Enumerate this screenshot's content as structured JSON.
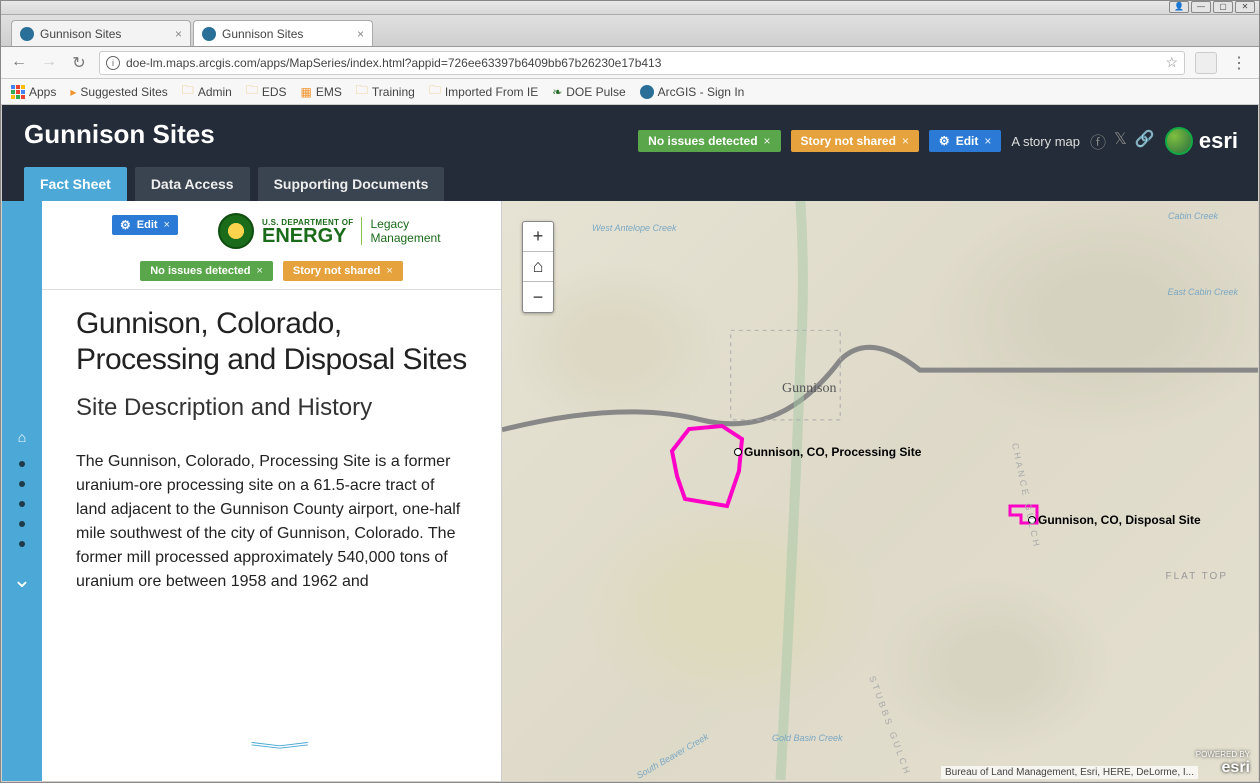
{
  "os": {
    "user": "👤",
    "min": "—",
    "max": "▢",
    "close": "✕"
  },
  "browser": {
    "tabs": [
      {
        "title": "Gunnison Sites",
        "active": false
      },
      {
        "title": "Gunnison Sites",
        "active": true
      }
    ],
    "url": "doe-lm.maps.arcgis.com/apps/MapSeries/index.html?appid=726ee63397b6409bb67b26230e17b413",
    "nav": {
      "back": "←",
      "fwd": "→",
      "reload": "↻"
    }
  },
  "bookmarks": [
    {
      "label": "Apps",
      "kind": "apps"
    },
    {
      "label": "Suggested Sites",
      "kind": "folder",
      "color": "#f0932b"
    },
    {
      "label": "Admin",
      "kind": "folder"
    },
    {
      "label": "EDS",
      "kind": "folder"
    },
    {
      "label": "EMS",
      "kind": "icon",
      "color": "#f0932b"
    },
    {
      "label": "Training",
      "kind": "folder"
    },
    {
      "label": "Imported From IE",
      "kind": "folder"
    },
    {
      "label": "DOE Pulse",
      "kind": "leaf"
    },
    {
      "label": "ArcGIS - Sign In",
      "kind": "globe"
    }
  ],
  "header": {
    "title": "Gunnison Sites",
    "issues_pill": "No issues detected",
    "share_pill": "Story not shared",
    "edit_pill": "Edit",
    "story_label": "A story map",
    "logo_text": "esri"
  },
  "app_tabs": [
    {
      "label": "Fact Sheet",
      "active": true
    },
    {
      "label": "Data Access",
      "active": false
    },
    {
      "label": "Supporting Documents",
      "active": false
    }
  ],
  "panel": {
    "edit_pill": "Edit",
    "issues_pill": "No issues detected",
    "share_pill": "Story not shared",
    "doe_small": "U.S. DEPARTMENT OF",
    "doe_big": "ENERGY",
    "doe_lm_1": "Legacy",
    "doe_lm_2": "Management",
    "heading": "Gunnison, Colorado, Processing and Disposal Sites",
    "subheading": "Site Description and History",
    "body": "The Gunnison, Colorado, Processing Site is a former uranium-ore processing site on a 61.5-acre tract of land adjacent to the Gunnison County airport, one-half mile southwest of the city of Gunnison, Colorado. The former mill processed approximately 540,000 tons of uranium ore between 1958 and 1962 and"
  },
  "map": {
    "zoom": {
      "in": "+",
      "home": "⌂",
      "out": "−"
    },
    "city_label": "Gunnison",
    "sites": [
      {
        "name": "Gunnison, CO, Processing Site"
      },
      {
        "name": "Gunnison, CO, Disposal Site"
      }
    ],
    "terrain_labels": {
      "flat_top": "FLAT TOP",
      "creek_w": "West Antelope Creek",
      "creek_ne1": "Cabin Creek",
      "creek_ne2": "East Cabin Creek",
      "creek_s1": "Gold Basin Creek",
      "creek_s2": "South Beaver Creek",
      "gulch1": "CHANCE GULCH",
      "gulch2": "STUBBS GULCH"
    },
    "attribution": "Bureau of Land Management, Esri, HERE, DeLorme, I...",
    "powered_by": "POWERED BY",
    "powered_logo": "esri"
  }
}
